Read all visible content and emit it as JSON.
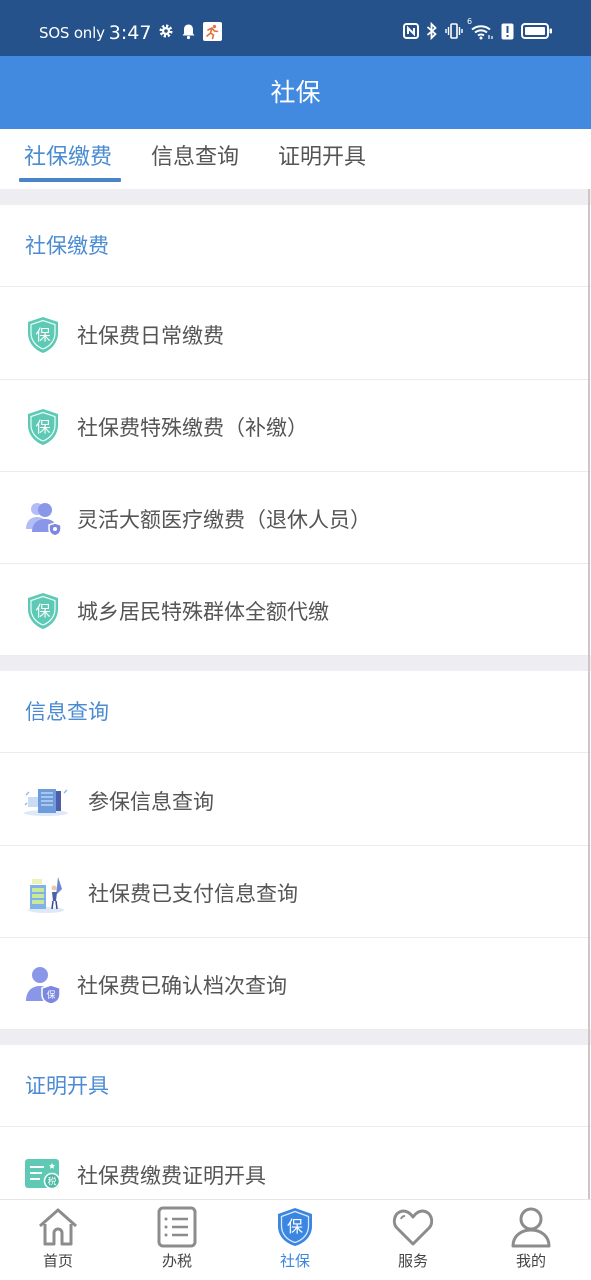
{
  "status_bar": {
    "carrier": "SOS only",
    "time": "3:47",
    "left_icons": [
      "gear-icon",
      "bell-icon",
      "running-app-icon"
    ],
    "right_icons": [
      "nfc-icon",
      "bluetooth-icon",
      "vibrate-icon",
      "wifi-6-icon",
      "alert-icon",
      "battery-icon"
    ],
    "wifi_badge": "6"
  },
  "header": {
    "title": "社保"
  },
  "tabs": [
    {
      "label": "社保缴费",
      "active": true
    },
    {
      "label": "信息查询",
      "active": false
    },
    {
      "label": "证明开具",
      "active": false
    }
  ],
  "sections": [
    {
      "title": "社保缴费",
      "items": [
        {
          "label": "社保费日常缴费",
          "icon": "shield-bao-icon"
        },
        {
          "label": "社保费特殊缴费（补缴）",
          "icon": "shield-bao-icon"
        },
        {
          "label": "灵活大额医疗缴费（退休人员）",
          "icon": "users-shield-icon"
        },
        {
          "label": "城乡居民特殊群体全额代缴",
          "icon": "shield-bao-icon"
        }
      ]
    },
    {
      "title": "信息查询",
      "items": [
        {
          "label": "参保信息查询",
          "icon": "document-illustration-icon"
        },
        {
          "label": "社保费已支付信息查询",
          "icon": "cabinet-illustration-icon"
        },
        {
          "label": "社保费已确认档次查询",
          "icon": "user-bao-icon"
        }
      ]
    },
    {
      "title": "证明开具",
      "items": [
        {
          "label": "社保费缴费证明开具",
          "icon": "tax-certificate-icon"
        }
      ]
    }
  ],
  "icon_glyphs": {
    "bao": "保",
    "shui": "税"
  },
  "bottom_nav": [
    {
      "label": "首页",
      "icon": "home-icon",
      "active": false
    },
    {
      "label": "办税",
      "icon": "list-icon",
      "active": false
    },
    {
      "label": "社保",
      "icon": "shield-bao-icon",
      "active": true
    },
    {
      "label": "服务",
      "icon": "heart-icon",
      "active": false
    },
    {
      "label": "我的",
      "icon": "user-icon",
      "active": false
    }
  ],
  "colors": {
    "status_bar": "#25528a",
    "header": "#418ae0",
    "accent": "#4a8bd2",
    "teal_shield": "#5ec9b4",
    "purple_icon": "#8a96e8",
    "gap": "#eeeef2"
  }
}
